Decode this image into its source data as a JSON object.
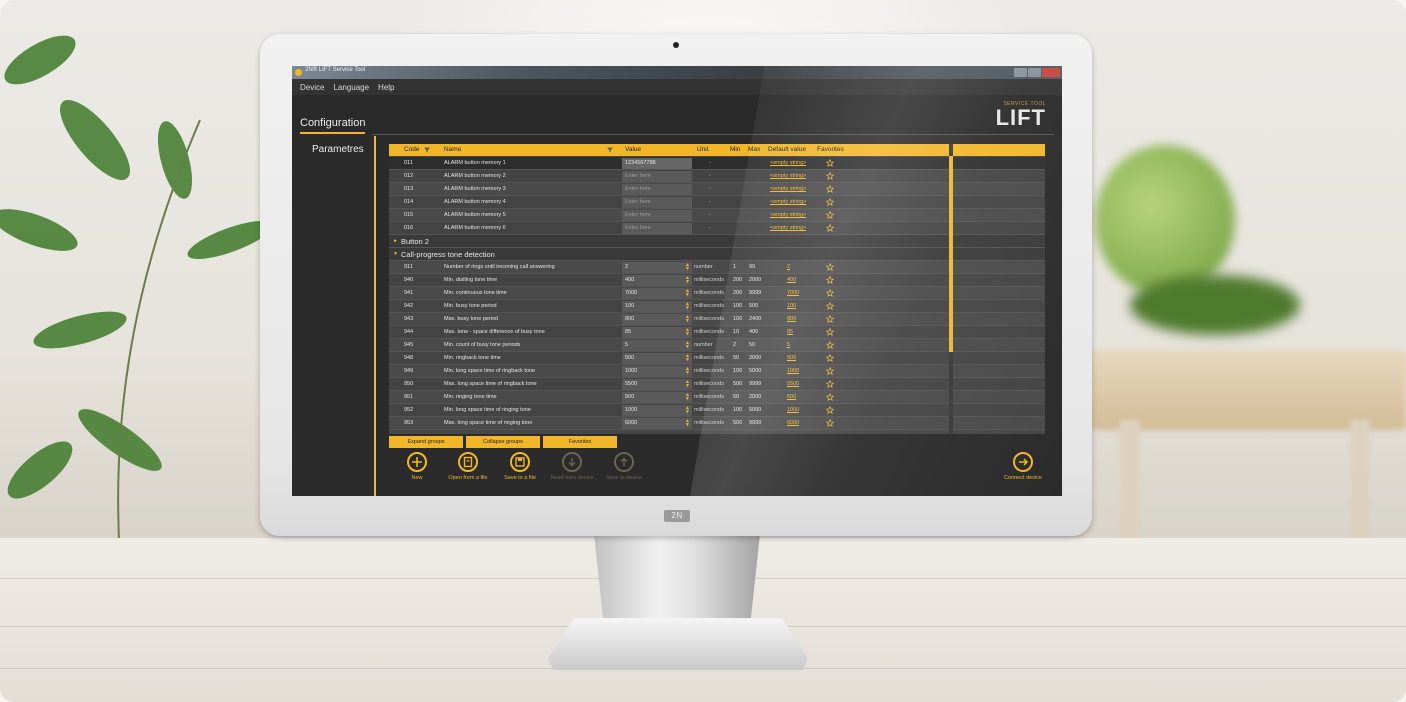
{
  "window": {
    "title": "2N® LIFT Service Tool"
  },
  "menu": [
    "Device",
    "Language",
    "Help"
  ],
  "header": {
    "tab": "Configuration",
    "logo_small": "SERVICE TOOL",
    "logo_big": "LIFT"
  },
  "sidebar": {
    "item": "Parametres"
  },
  "monitor": {
    "brand": "2N"
  },
  "grid": {
    "columns": {
      "code": "Code",
      "name": "Name",
      "value": "Value",
      "unit": "Unit",
      "min": "Min",
      "max": "Max",
      "default": "Default value",
      "favorites": "Favorites"
    },
    "rows_top": [
      {
        "code": "011",
        "name": "ALARM button memory 1",
        "value": "1234567788",
        "unit": "-",
        "default": "<empty string>",
        "selected": true
      },
      {
        "code": "012",
        "name": "ALARM button memory 2",
        "value": "Enter here",
        "unit": "-",
        "default": "<empty string>"
      },
      {
        "code": "013",
        "name": "ALARM button memory 3",
        "value": "Enter here",
        "unit": "-",
        "default": "<empty string>"
      },
      {
        "code": "014",
        "name": "ALARM button memory 4",
        "value": "Enter here",
        "unit": "-",
        "default": "<empty string>"
      },
      {
        "code": "015",
        "name": "ALARM button memory 5",
        "value": "Enter here",
        "unit": "-",
        "default": "<empty string>"
      },
      {
        "code": "016",
        "name": "ALARM button memory 6",
        "value": "Enter here",
        "unit": "-",
        "default": "<empty string>"
      }
    ],
    "group_button2": "Button 2",
    "group_cpt": "Call-progress tone detection",
    "rows_cpt": [
      {
        "code": "911",
        "name": "Number of rings until incoming call answering",
        "value": "2",
        "unit": "number",
        "min": "1",
        "max": "99",
        "default": "2"
      },
      {
        "code": "940",
        "name": "Min. dialling tone time",
        "value": "400",
        "unit": "milliseconds",
        "min": "200",
        "max": "2000",
        "default": "400"
      },
      {
        "code": "941",
        "name": "Min. continuous tone time",
        "value": "7000",
        "unit": "milliseconds",
        "min": "200",
        "max": "9999",
        "default": "7000"
      },
      {
        "code": "942",
        "name": "Min. busy tone period",
        "value": "100",
        "unit": "milliseconds",
        "min": "100",
        "max": "500",
        "default": "100"
      },
      {
        "code": "943",
        "name": "Max. busy tone period",
        "value": "800",
        "unit": "milliseconds",
        "min": "100",
        "max": "2400",
        "default": "800"
      },
      {
        "code": "944",
        "name": "Max. tone - space difference of busy tone",
        "value": "85",
        "unit": "milliseconds",
        "min": "10",
        "max": "400",
        "default": "85"
      },
      {
        "code": "945",
        "name": "Min. count of busy tone periods",
        "value": "5",
        "unit": "number",
        "min": "2",
        "max": "50",
        "default": "5"
      },
      {
        "code": "948",
        "name": "Min. ringback tone time",
        "value": "500",
        "unit": "milliseconds",
        "min": "50",
        "max": "2000",
        "default": "500"
      },
      {
        "code": "949",
        "name": "Min. long space time of ringback tone",
        "value": "1000",
        "unit": "milliseconds",
        "min": "100",
        "max": "5000",
        "default": "1000"
      },
      {
        "code": "950",
        "name": "Max. long space time of ringback tone",
        "value": "5500",
        "unit": "milliseconds",
        "min": "500",
        "max": "9999",
        "default": "5500"
      },
      {
        "code": "951",
        "name": "Min. ringing tone time",
        "value": "500",
        "unit": "milliseconds",
        "min": "50",
        "max": "2000",
        "default": "500"
      },
      {
        "code": "952",
        "name": "Min. long space time of ringing tone",
        "value": "1000",
        "unit": "milliseconds",
        "min": "100",
        "max": "5000",
        "default": "1000"
      },
      {
        "code": "953",
        "name": "Max. long space time of ringing tone",
        "value": "6000",
        "unit": "milliseconds",
        "min": "500",
        "max": "9999",
        "default": "6000"
      }
    ]
  },
  "buttons": {
    "expand": "Expand groups",
    "collapse": "Collapse groups",
    "favorites": "Favorites"
  },
  "toolbar": {
    "new": "New",
    "open": "Open from a file",
    "save": "Save to a file",
    "read": "Read from device",
    "save_device": "Save to device",
    "connect": "Connect device"
  },
  "colors": {
    "accent": "#f2b729",
    "background": "#2b2b2b",
    "grid": "#474747"
  }
}
